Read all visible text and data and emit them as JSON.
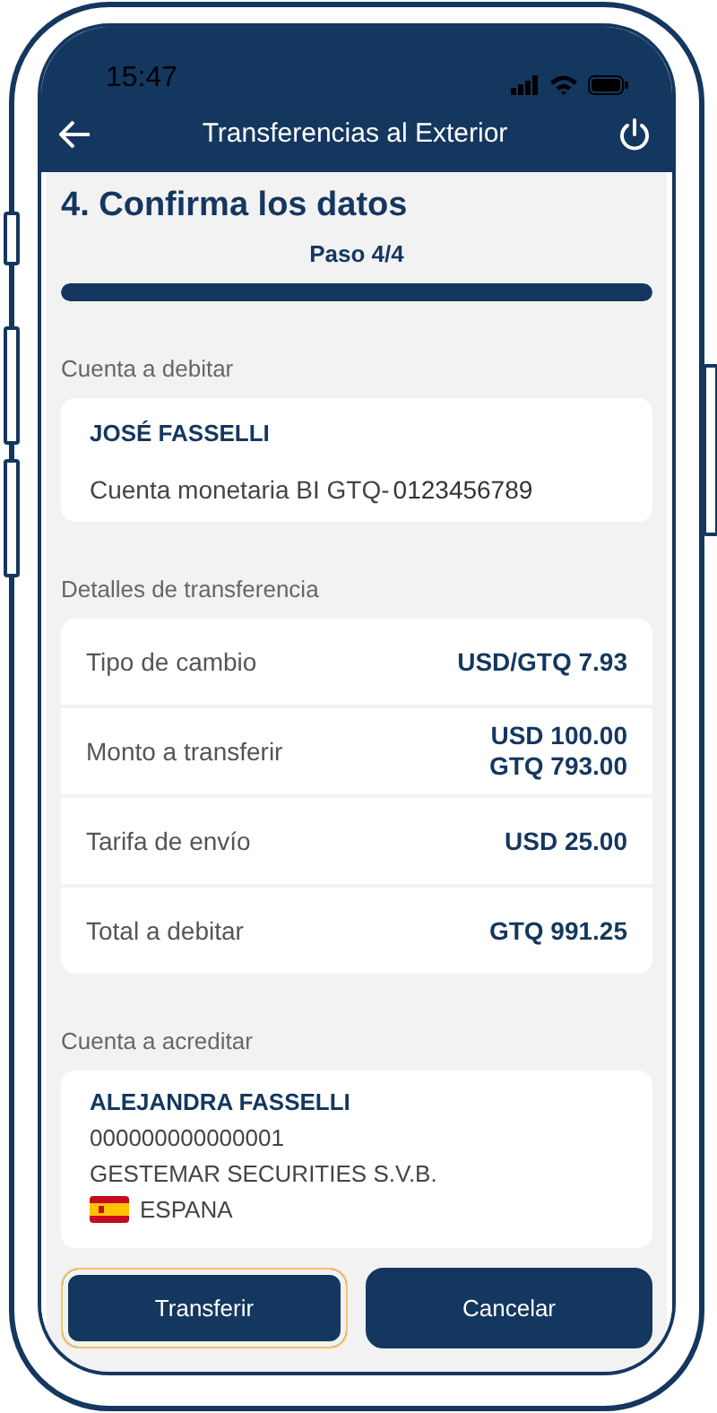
{
  "status_bar": {
    "time": "15:47"
  },
  "header": {
    "title": "Transferencias al Exterior"
  },
  "step": {
    "title": "4. Confirma los datos",
    "label": "Paso 4/4",
    "level": 1
  },
  "debit": {
    "heading": "Cuenta a debitar",
    "name": "JOSÉ FASSELLI",
    "account_label": "Cuenta monetaria BI GTQ-",
    "account_number": "0123456789"
  },
  "details": {
    "heading": "Detalles de transferencia",
    "rows": [
      {
        "label": "Tipo de cambio",
        "values": [
          "USD/GTQ 7.93"
        ]
      },
      {
        "label": "Monto a transferir",
        "values": [
          "USD 100.00",
          "GTQ 793.00"
        ]
      },
      {
        "label": "Tarifa de envío",
        "values": [
          "USD 25.00"
        ]
      },
      {
        "label": "Total a debitar",
        "values": [
          "GTQ 991.25"
        ]
      }
    ]
  },
  "credit": {
    "heading": "Cuenta a acreditar",
    "name": "ALEJANDRA FASSELLI",
    "account_number": "000000000000001",
    "bank": "GESTEMAR SECURITIES S.V.B.",
    "country": "ESPANA"
  },
  "buttons": [
    {
      "label": "Transferir",
      "focused": true
    },
    {
      "label": "Cancelar",
      "focused": false
    }
  ]
}
